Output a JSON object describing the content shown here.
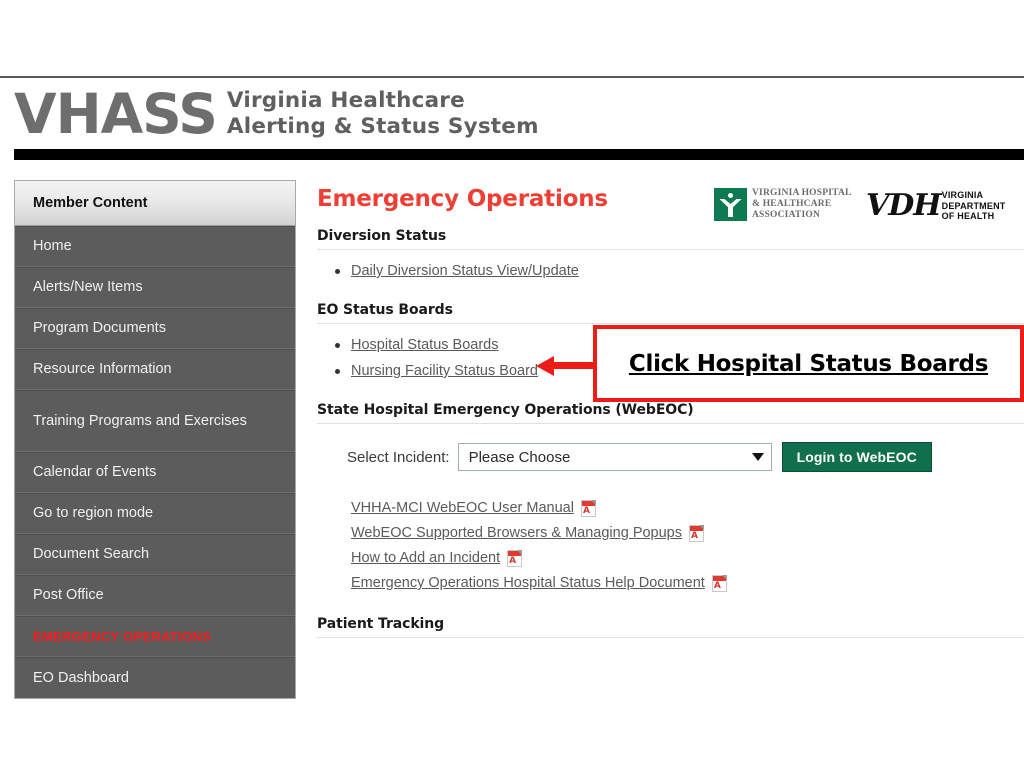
{
  "header": {
    "brand_acronym": "VHASS",
    "brand_line1": "Virginia  Healthcare",
    "brand_line2": "Alerting & Status System",
    "vhha_logo": {
      "line1": "VIRGINIA HOSPITAL",
      "line2": "& HEALTHCARE",
      "line3": "ASSOCIATION",
      "mark_color": "#0e7a52"
    },
    "vdh_logo": {
      "mark": "VDH",
      "line1": "VIRGINIA",
      "line2": "DEPARTMENT",
      "line3": "OF HEALTH"
    }
  },
  "sidebar": {
    "header_label": "Member Content",
    "items": [
      {
        "label": "Home"
      },
      {
        "label": "Alerts/New Items"
      },
      {
        "label": "Program Documents"
      },
      {
        "label": "Resource Information"
      },
      {
        "label": "Training Programs and Exercises"
      },
      {
        "label": "Calendar of Events"
      },
      {
        "label": "Go to region mode"
      },
      {
        "label": "Document Search"
      },
      {
        "label": "Post Office"
      },
      {
        "label": "EMERGENCY OPERATIONS"
      },
      {
        "label": "EO Dashboard"
      }
    ]
  },
  "main": {
    "page_title": "Emergency Operations",
    "sections": {
      "diversion": {
        "heading": "Diversion Status",
        "links": [
          "Daily Diversion Status View/Update"
        ]
      },
      "status_boards": {
        "heading": "EO Status Boards",
        "links": [
          "Hospital Status Boards",
          "Nursing Facility Status Board"
        ]
      },
      "webeoc": {
        "heading": "State Hospital Emergency Operations (WebEOC)",
        "select_label": "Select Incident:",
        "select_value": "Please Choose",
        "login_button": "Login to WebEOC",
        "documents": [
          {
            "label": "VHHA-MCI WebEOC User Manual",
            "icon": "pdf-icon"
          },
          {
            "label": "WebEOC Supported Browsers & Managing Popups",
            "icon": "pdf-icon"
          },
          {
            "label": "How to Add an Incident",
            "icon": "pdf-icon"
          },
          {
            "label": "Emergency Operations Hospital Status Help Document",
            "icon": "pdf-icon"
          }
        ]
      },
      "patient_tracking": {
        "heading": "Patient Tracking"
      }
    }
  },
  "annotation": {
    "callout_text": "Click Hospital Status Boards",
    "border_color": "#ee1c16",
    "arrow_color": "#ee1c16"
  },
  "colors": {
    "title_red": "#ef3e33",
    "sidebar_bg": "#5c5c5c",
    "emergency_red": "#ff1a1a",
    "login_green": "#10704b"
  }
}
